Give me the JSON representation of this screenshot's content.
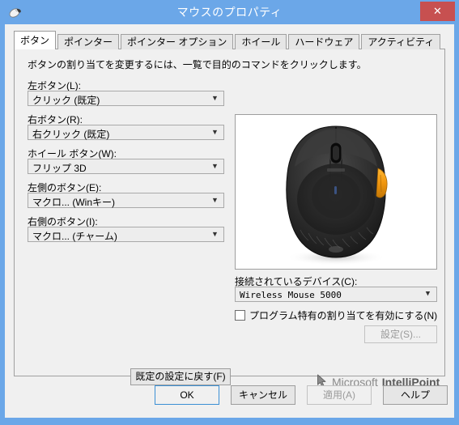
{
  "window": {
    "title": "マウスのプロパティ",
    "icon": "mouse-icon",
    "close_label": "✕",
    "titlebar_color": "#6ba7e8",
    "close_color": "#c75050"
  },
  "tabs": [
    {
      "label": "ボタン",
      "active": true
    },
    {
      "label": "ポインター",
      "active": false
    },
    {
      "label": "ポインター オプション",
      "active": false
    },
    {
      "label": "ホイール",
      "active": false
    },
    {
      "label": "ハードウェア",
      "active": false
    },
    {
      "label": "アクティビティ",
      "active": false
    }
  ],
  "page": {
    "instruction": "ボタンの割り当てを変更するには、一覧で目的のコマンドをクリックします。",
    "button_assignments": [
      {
        "label": "左ボタン(L):",
        "value": "クリック (既定)"
      },
      {
        "label": "右ボタン(R):",
        "value": "右クリック (既定)"
      },
      {
        "label": "ホイール ボタン(W):",
        "value": "フリップ 3D"
      },
      {
        "label": "左側のボタン(E):",
        "value": "マクロ... (Winキー)"
      },
      {
        "label": "右側のボタン(I):",
        "value": "マクロ... (チャーム)"
      }
    ],
    "device": {
      "label": "接続されているデバイス(C):",
      "value": "Wireless Mouse 5000"
    },
    "program_checkbox": {
      "label": "プログラム特有の割り当てを有効にする(N)",
      "checked": false
    },
    "settings_button": {
      "label": "設定(S)...",
      "enabled": false
    },
    "restore_button": {
      "label": "既定の設定に戻す(F)",
      "enabled": true
    },
    "branding": {
      "cursor_icon": "cursor-arrow-icon",
      "company": "Microsoft",
      "product": "IntelliPoint"
    },
    "mouse_preview": {
      "body_color": "#2b2b2b",
      "accent_color": "#f0960f"
    }
  },
  "actions": [
    {
      "label": "OK",
      "enabled": true,
      "default": true,
      "name": "ok-button"
    },
    {
      "label": "キャンセル",
      "enabled": true,
      "default": false,
      "name": "cancel-button"
    },
    {
      "label": "適用(A)",
      "enabled": false,
      "default": false,
      "name": "apply-button"
    },
    {
      "label": "ヘルプ",
      "enabled": true,
      "default": false,
      "name": "help-button"
    }
  ]
}
